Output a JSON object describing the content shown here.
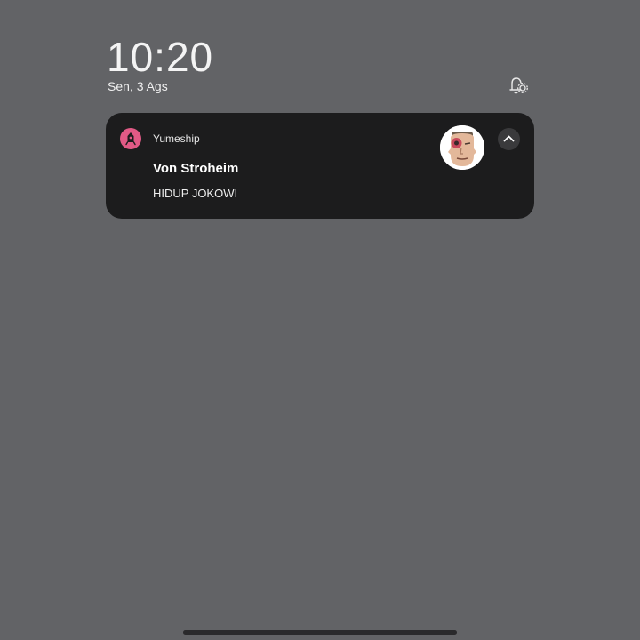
{
  "lockscreen": {
    "time": "10:20",
    "date": "Sen, 3 Ags"
  },
  "notification": {
    "app_name": "Yumeship",
    "title": "Von Stroheim",
    "message": "HIDUP JOKOWI",
    "app_icon": "yumeship-app-icon",
    "avatar_icon": "contact-avatar",
    "expand_icon": "chevron-up-icon",
    "accent_color": "#e15a86",
    "card_color": "#1c1c1d"
  },
  "settings_icon": "notification-settings-icon",
  "background_color": "#626366"
}
